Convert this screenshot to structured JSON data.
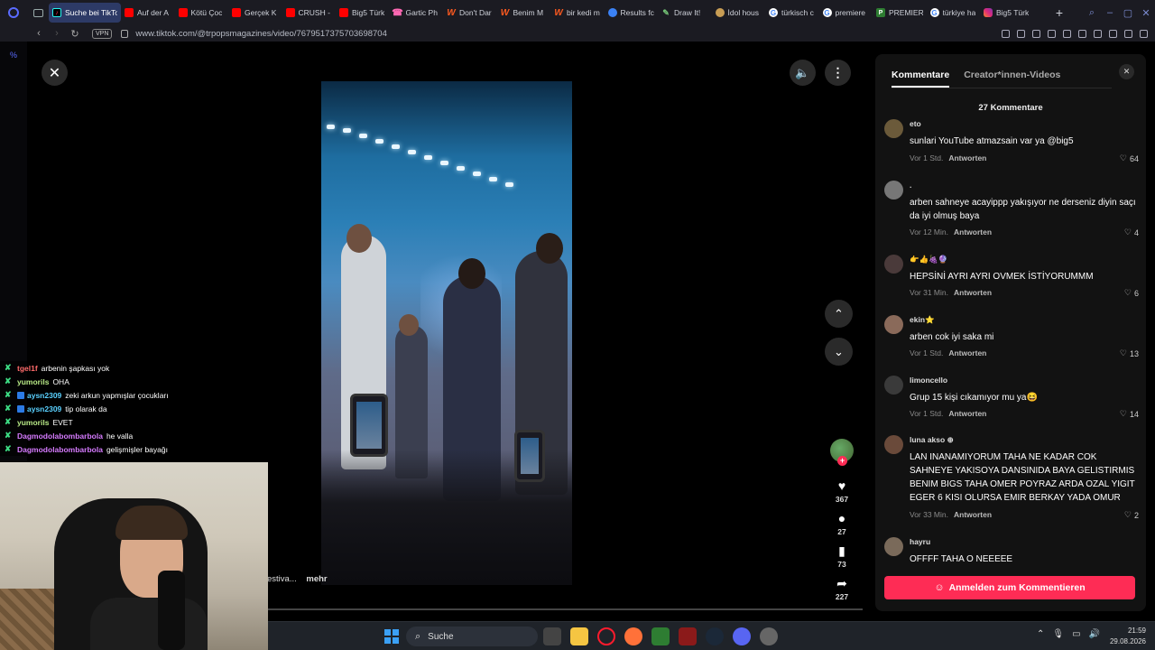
{
  "browser": {
    "tabs": [
      {
        "label": "Suche bei TikTok",
        "icon": "tiktok-icon",
        "active": true
      },
      {
        "label": "Auf der A",
        "icon": "youtube-icon"
      },
      {
        "label": "Kötü Çoc",
        "icon": "youtube-icon"
      },
      {
        "label": "Gerçek K",
        "icon": "youtube-icon"
      },
      {
        "label": "CRUSH -",
        "icon": "youtube-icon"
      },
      {
        "label": "Big5 Türk",
        "icon": "youtube-icon"
      },
      {
        "label": "Gartic Ph",
        "icon": "gartic-icon"
      },
      {
        "label": "Don't Dar",
        "icon": "w-icon"
      },
      {
        "label": "Benim M",
        "icon": "w-icon"
      },
      {
        "label": "bir kedi m",
        "icon": "w-icon"
      },
      {
        "label": "Results fc",
        "icon": "results-icon"
      },
      {
        "label": "Draw It!",
        "icon": "draw-icon"
      },
      {
        "label": "İdol hous",
        "icon": "idol-icon"
      },
      {
        "label": "türkisch c",
        "icon": "google-icon"
      },
      {
        "label": "premiere",
        "icon": "google-icon"
      },
      {
        "label": "PREMIER",
        "icon": "premiere-icon"
      },
      {
        "label": "türkiye ha",
        "icon": "google-icon"
      },
      {
        "label": "Big5 Türk",
        "icon": "instagram-icon"
      }
    ],
    "new_tab": "+",
    "vpn_label": "VPN",
    "url": "www.tiktok.com/@trpopsmagazines/video/7679517375703698704",
    "sidebar_symbol": "%"
  },
  "player": {
    "close": "✕",
    "volume": "🔈",
    "more": "⋮",
    "nav_up": "⌃",
    "nav_down": "⌄",
    "caption_text": "estiva...",
    "caption_more": "mehr",
    "actions": {
      "likes": "367",
      "comments": "27",
      "saves": "73",
      "shares": "227"
    }
  },
  "chat": [
    {
      "name": "tgel1f",
      "msg": "arbenin şapkası yok",
      "color": "#ff6b6b",
      "badge": "x"
    },
    {
      "name": "yumorils",
      "msg": "OHA",
      "color": "#b8e986",
      "badge": "x"
    },
    {
      "name": "aysn2309",
      "msg": "zeki arkun yapmışlar çocukları",
      "color": "#5ad1ff",
      "badge": "xb"
    },
    {
      "name": "aysn2309",
      "msg": "tip olarak da",
      "color": "#5ad1ff",
      "badge": "xb"
    },
    {
      "name": "yumorils",
      "msg": "EVET",
      "color": "#b8e986",
      "badge": "x"
    },
    {
      "name": "Dagmodolabombarbola",
      "msg": "he valla",
      "color": "#d67bff",
      "badge": "x"
    },
    {
      "name": "Dagmodolabombarbola",
      "msg": "gelişmişler bayağı",
      "color": "#d67bff",
      "badge": "x"
    }
  ],
  "comments_panel": {
    "tab_comments": "Kommentare",
    "tab_creator_videos": "Creator*innen-Videos",
    "close": "✕",
    "count": "27 Kommentare",
    "reply_label": "Antworten",
    "comments": [
      {
        "name": "eto",
        "text": "sunlari YouTube atmazsain var ya @big5",
        "time": "Vor 1 Std.",
        "likes": "64",
        "avatar": "#6b5a3a"
      },
      {
        "name": ".",
        "text": "arben sahneye acayippp yakışıyor ne derseniz diyin saçı da iyi olmuş baya",
        "time": "Vor 12 Min.",
        "likes": "4",
        "avatar": "#777"
      },
      {
        "name": "👉👍🍇🔮",
        "text": "HEPSİNİ AYRI AYRI OVMEK İSTİYORUMMM",
        "time": "Vor 31 Min.",
        "likes": "6",
        "avatar": "#4a3a3a"
      },
      {
        "name": "ekin⭐",
        "text": "arben cok iyi saka mi",
        "time": "Vor 1 Std.",
        "likes": "13",
        "avatar": "#8a6a5a"
      },
      {
        "name": "limoncello",
        "text": "Grup 15 kişi cıkamıyor mu ya😆",
        "time": "Vor 1 Std.",
        "likes": "14",
        "avatar": "#3a3a3a"
      },
      {
        "name": "luna akso ⊕",
        "text": "LAN INANAMIYORUM TAHA NE KADAR COK SAHNEYE YAKISOYA DANSINIDA BAYA GELISTIRMIS BENIM BIGS TAHA OMER POYRAZ ARDA OZAL YIGIT EGER 6 KISI OLURSA EMIR BERKAY YADA OMUR",
        "time": "Vor 33 Min.",
        "likes": "2",
        "avatar": "#6a4a3a"
      },
      {
        "name": "hayru",
        "text": "OFFFF TAHA O NEEEEE",
        "time": "",
        "likes": "",
        "avatar": "#7a6a5a"
      }
    ],
    "login_button": "Anmelden zum Kommentieren"
  },
  "taskbar": {
    "search_placeholder": "Suche",
    "time": "21:59",
    "date": "29.08.2026"
  }
}
